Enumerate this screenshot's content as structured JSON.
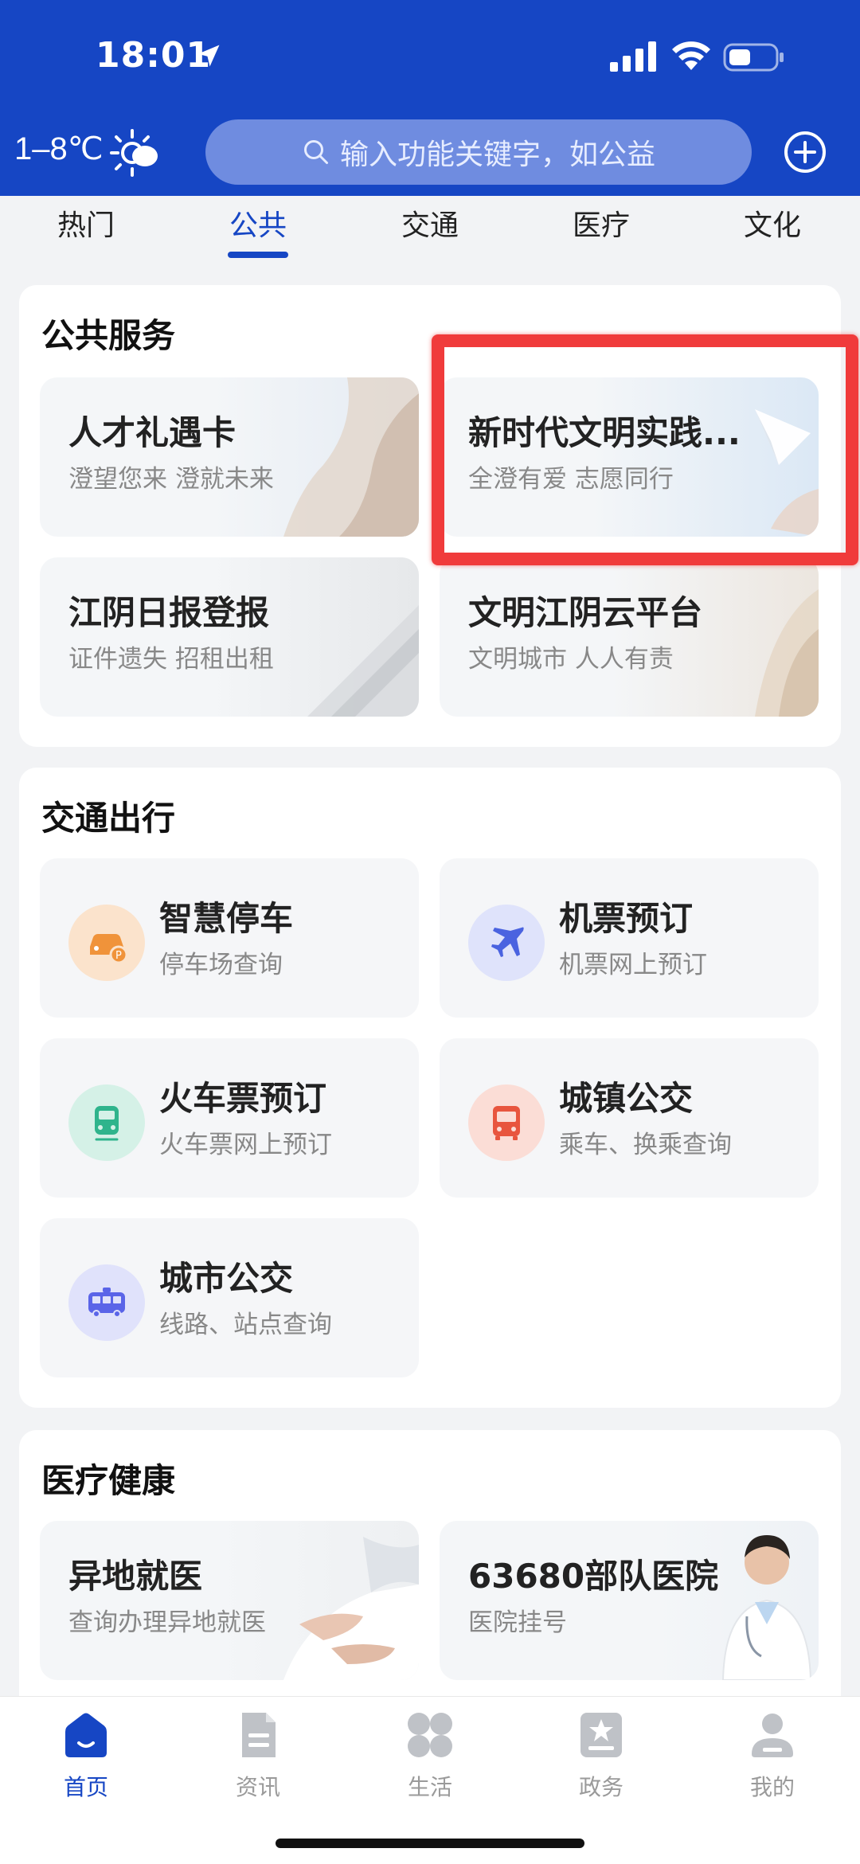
{
  "status_bar": {
    "time": "18:01"
  },
  "header": {
    "weather": "1–8℃",
    "search_placeholder": "输入功能关键字，如公益"
  },
  "tabs": [
    {
      "label": "热门",
      "active": false
    },
    {
      "label": "公共",
      "active": true
    },
    {
      "label": "交通",
      "active": false
    },
    {
      "label": "医疗",
      "active": false
    },
    {
      "label": "文化",
      "active": false
    }
  ],
  "public_services": {
    "title": "公共服务",
    "cards": [
      {
        "title": "人才礼遇卡",
        "subtitle": "澄望您来 澄就未来"
      },
      {
        "title": "新时代文明实践...",
        "subtitle": "全澄有爱 志愿同行"
      },
      {
        "title": "江阴日报登报",
        "subtitle": "证件遗失 招租出租"
      },
      {
        "title": "文明江阴云平台",
        "subtitle": "文明城市 人人有责"
      }
    ]
  },
  "transport": {
    "title": "交通出行",
    "cards": [
      {
        "title": "智慧停车",
        "subtitle": "停车场查询",
        "icon": "car-parking-icon",
        "color": "#f0933a"
      },
      {
        "title": "机票预订",
        "subtitle": "机票网上预订",
        "icon": "airplane-icon",
        "color": "#4a63e0"
      },
      {
        "title": "火车票预订",
        "subtitle": "火车票网上预订",
        "icon": "train-icon",
        "color": "#2fb48c"
      },
      {
        "title": "城镇公交",
        "subtitle": "乘车、换乘查询",
        "icon": "bus-icon",
        "color": "#e8553e"
      },
      {
        "title": "城市公交",
        "subtitle": "线路、站点查询",
        "icon": "city-bus-icon",
        "color": "#5a64e8"
      }
    ]
  },
  "medical": {
    "title": "医疗健康",
    "cards": [
      {
        "title": "异地就医",
        "subtitle": "查询办理异地就医"
      },
      {
        "title": "63680部队医院",
        "subtitle": "医院挂号"
      }
    ]
  },
  "bottom_nav": [
    {
      "label": "首页",
      "icon": "home-icon",
      "active": true
    },
    {
      "label": "资讯",
      "icon": "news-icon",
      "active": false
    },
    {
      "label": "生活",
      "icon": "life-icon",
      "active": false
    },
    {
      "label": "政务",
      "icon": "government-icon",
      "active": false
    },
    {
      "label": "我的",
      "icon": "profile-icon",
      "active": false
    }
  ],
  "colors": {
    "brand": "#1646c4",
    "highlight": "#f03b3b"
  }
}
